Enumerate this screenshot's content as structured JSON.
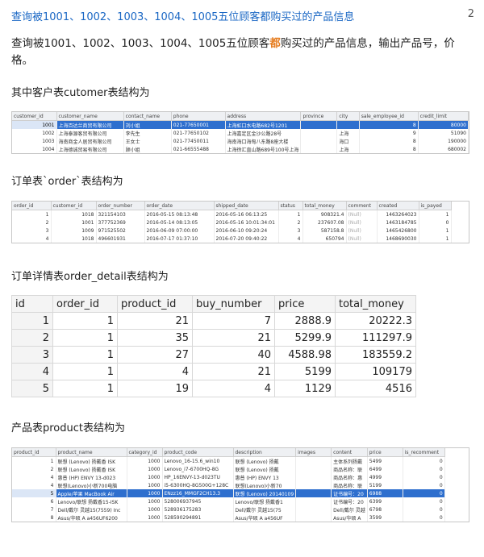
{
  "header": {
    "title": "查询被1001、1002、1003、1004、1005五位顾客都购买过的产品信息",
    "count": "2"
  },
  "question": {
    "part1": "查询被1001、1002、1003、1004、1005五位顾客",
    "accent": "都",
    "part2": "购买过的产品信息，输出产品号，价格。"
  },
  "customer": {
    "label": "其中客户表cutomer表结构为",
    "columns": [
      "customer_id",
      "customer_name",
      "contact_name",
      "phone",
      "address",
      "province",
      "city",
      "sale_employee_id",
      "credit_limit"
    ],
    "rows": [
      [
        "1001",
        "上海百达兰商贸有限公司",
        "刘小姐",
        "021-77650001",
        "上海虹口水电路682号1201",
        "",
        "",
        "8",
        "80000"
      ],
      [
        "1002",
        "上海泰源客贸有限公司",
        "李先生",
        "021-77650102",
        "上海嘉定区金沙公路28号",
        "",
        "上海",
        "9",
        "51090"
      ],
      [
        "1003",
        "海南商金人居贸有限公司",
        "王女士",
        "021-77450011",
        "海南海口海甸八东路8座大楼",
        "",
        "海口",
        "8",
        "190000"
      ],
      [
        "1004",
        "上海德诚贸易有限公司",
        "顾小姐",
        "021-66555488",
        "上海徐汇直山路689号100号上海",
        "",
        "上海",
        "8",
        "680002"
      ]
    ]
  },
  "order": {
    "label": "订单表`order`表结构为",
    "columns": [
      "order_id",
      "customer_id",
      "order_number",
      "order_date",
      "shipped_date",
      "status",
      "total_money",
      "comment",
      "created",
      "is_payed"
    ],
    "rows": [
      [
        "1",
        "1018",
        "321154103",
        "2016-05-15 08:13:48",
        "2016-05-16 06:13:25",
        "1",
        "908321.4",
        "(Null)",
        "1463264023",
        "1"
      ],
      [
        "2",
        "1001",
        "377752369",
        "2016-05-14 08:13:05",
        "2016-05-16 10:01:34:01",
        "2",
        "237607.08",
        "(Null)",
        "1463184785",
        "0"
      ],
      [
        "3",
        "1009",
        "971525502",
        "2016-06-09 07:00:00",
        "2016-06-10 09:20:24",
        "3",
        "587158.8",
        "(Null)",
        "1465426800",
        "1"
      ],
      [
        "4",
        "1018",
        "496601931",
        "2016-07-17 01:37:10",
        "2016-07-20 09:40:22",
        "4",
        "650794",
        "(Null)",
        "1468690030",
        "1"
      ]
    ]
  },
  "order_detail": {
    "label": "订单详情表order_detail表结构为",
    "columns": [
      "id",
      "order_id",
      "product_id",
      "buy_number",
      "price",
      "total_money"
    ],
    "rows": [
      [
        "1",
        "1",
        "21",
        "7",
        "2888.9",
        "20222.3"
      ],
      [
        "2",
        "1",
        "35",
        "21",
        "5299.9",
        "111297.9"
      ],
      [
        "3",
        "1",
        "27",
        "40",
        "4588.98",
        "183559.2"
      ],
      [
        "4",
        "1",
        "4",
        "21",
        "5199",
        "109179"
      ],
      [
        "5",
        "1",
        "19",
        "4",
        "1129",
        "4516"
      ]
    ]
  },
  "product": {
    "label": "产品表product表结构为",
    "columns": [
      "product_id",
      "product_name",
      "category_id",
      "product_code",
      "description",
      "images",
      "content",
      "price",
      "is_recomment"
    ],
    "rows": [
      [
        "1",
        "联想 (Lenovo) 扬戴香 ISK",
        "1000",
        "Lenovo_16-15.6_win10",
        "联想 (Lenovo) 扬戴",
        "",
        "主体系列扬戴",
        "5499",
        "0"
      ],
      [
        "2",
        "联想 (Lenovo) 扬戴香 ISK",
        "1000",
        "Lenovo_i7-6700HQ-8G",
        "联想 (Lenovo) 扬戴",
        "",
        "商品名称：联",
        "6499",
        "0"
      ],
      [
        "4",
        "惠普 (HP) ENVY 13-d023",
        "1000",
        "HP_16ENVY-13-d023TU",
        "惠普 (HP) ENVY 13",
        "",
        "商品名称：惠",
        "4999",
        "0"
      ],
      [
        "4",
        "联想(Lenovo)小新700电脑",
        "1000",
        "i5-6300HQ-8G500G+128C",
        "联想(Lenovo)小新70",
        "",
        "商品名称：联",
        "5199",
        "0"
      ],
      [
        "5",
        "Apple/苹果 MacBook Air",
        "1000",
        "ENzz16_MMGF2CH13.3",
        "联想 (Lenovo) 20140109",
        "",
        "证书编号：20",
        "6988",
        "0"
      ],
      [
        "6",
        "Lenovo/联想 扬戴香15-ISK",
        "1000",
        "528006937945",
        "Lenovo/联想 扬戴香1",
        "",
        "证书编号：20",
        "6399",
        "0"
      ],
      [
        "7",
        "Dell/戴尔 灵越15(7559) Inc",
        "1000",
        "528936175283",
        "Dell/戴尔 灵越15(75",
        "",
        "Dell/戴尔 灵越",
        "6798",
        "0"
      ],
      [
        "8",
        "Asus/华硕 A a456UF6200",
        "1000",
        "528590294891",
        "Asus/华硕 A a456UF",
        "",
        "Asus/华硕 A",
        "3599",
        "0"
      ]
    ]
  }
}
